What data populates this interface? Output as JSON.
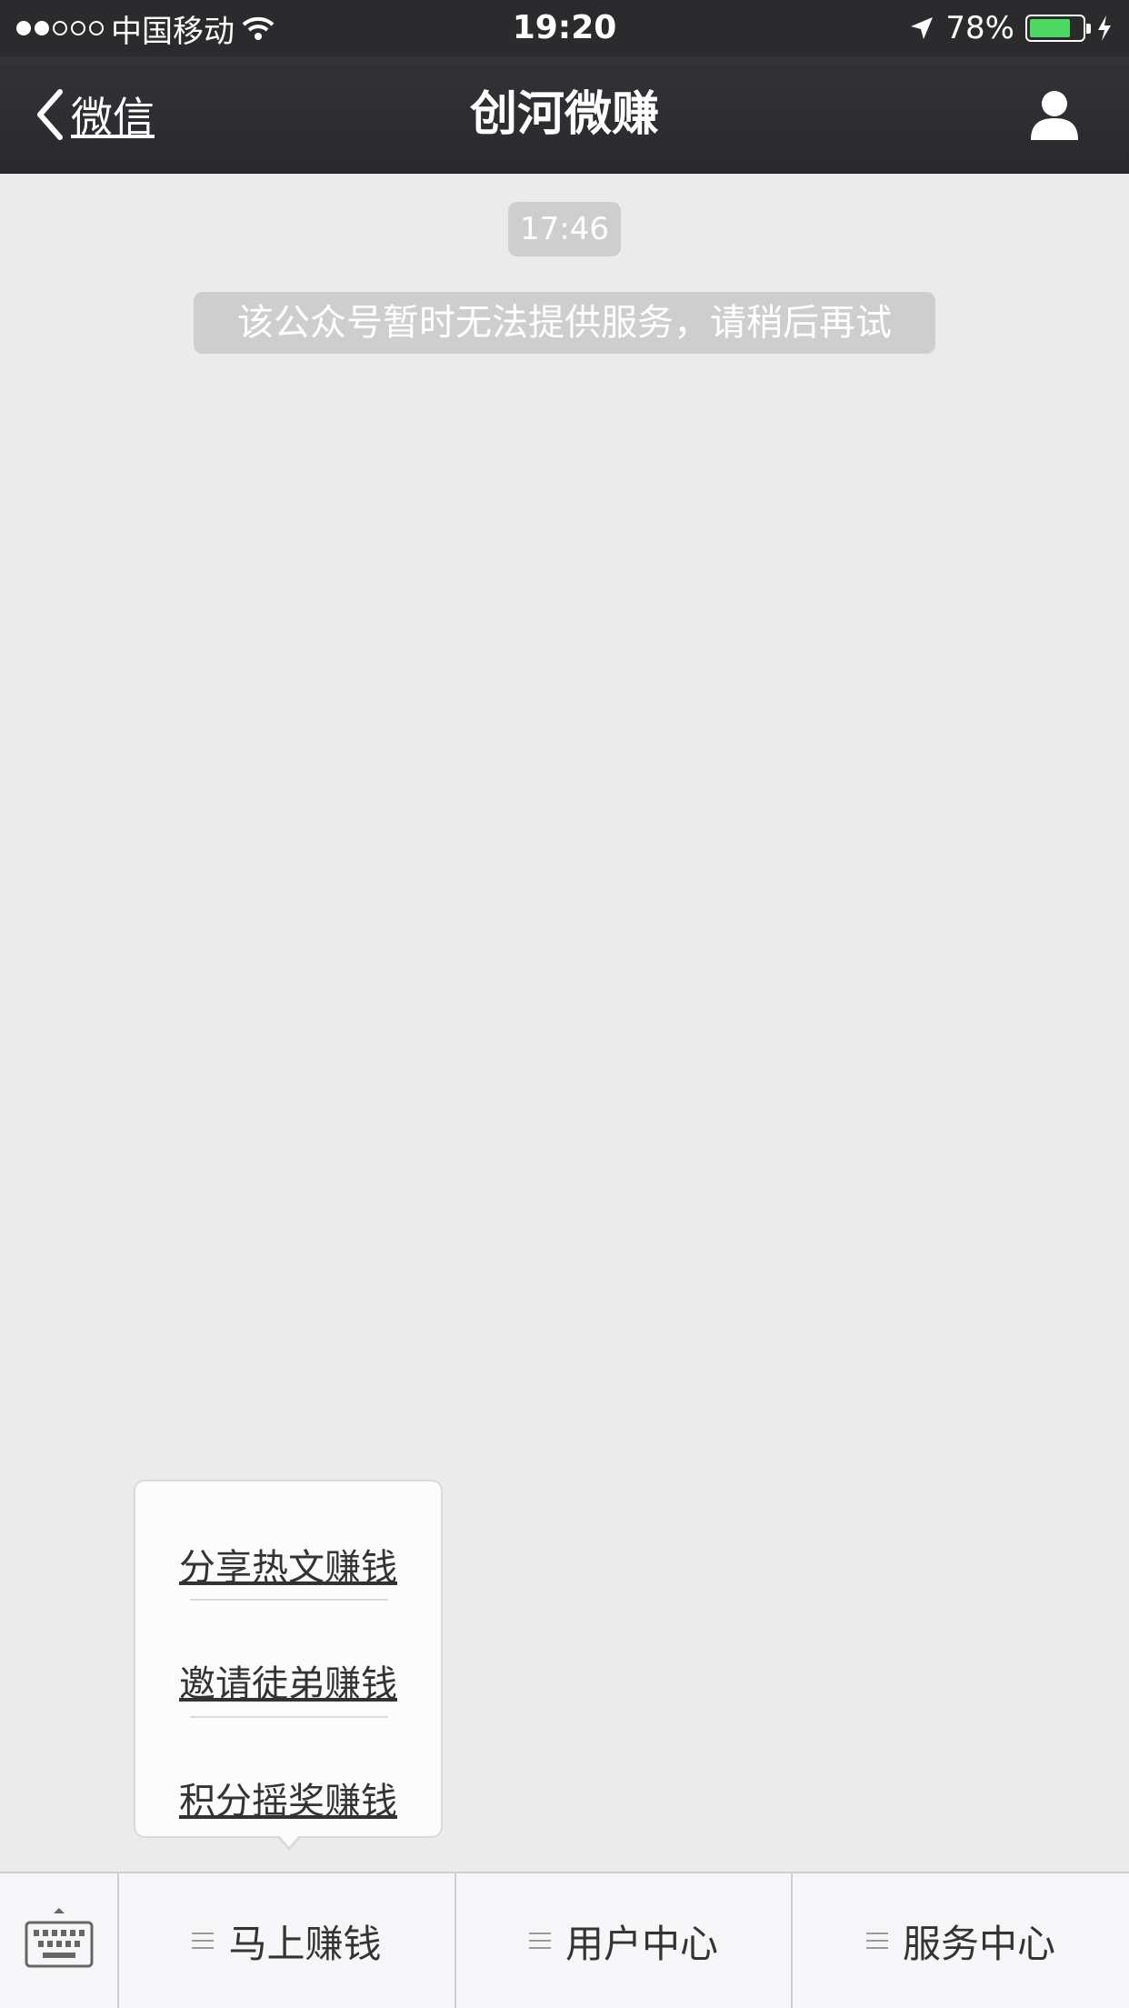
{
  "status_bar": {
    "carrier": "中国移动",
    "time": "19:20",
    "battery_percent": "78%",
    "battery_level": 0.78,
    "signal_bars": 2,
    "icons": [
      "signal-dots-icon",
      "wifi-icon",
      "location-arrow-icon",
      "battery-icon",
      "charging-bolt-icon"
    ]
  },
  "nav": {
    "back_label": "微信",
    "title": "创河微赚",
    "profile_icon": "person-icon"
  },
  "chat": {
    "timestamp": "17:46",
    "system_message": "该公众号暂时无法提供服务，请稍后再试"
  },
  "popup_menu": {
    "items": [
      {
        "label": "分享热文赚钱"
      },
      {
        "label": "邀请徒弟赚钱"
      },
      {
        "label": "积分摇奖赚钱"
      }
    ]
  },
  "bottom_menu": {
    "keyboard_icon": "keyboard-icon",
    "tabs": [
      {
        "label": "马上赚钱",
        "icon": "hamburger-icon"
      },
      {
        "label": "用户中心",
        "icon": "hamburger-icon"
      },
      {
        "label": "服务中心",
        "icon": "hamburger-icon"
      }
    ]
  },
  "colors": {
    "navbar": "#2b2b2e",
    "background": "#ebebeb",
    "pill": "#cecece",
    "battery_fill": "#4cd964"
  }
}
